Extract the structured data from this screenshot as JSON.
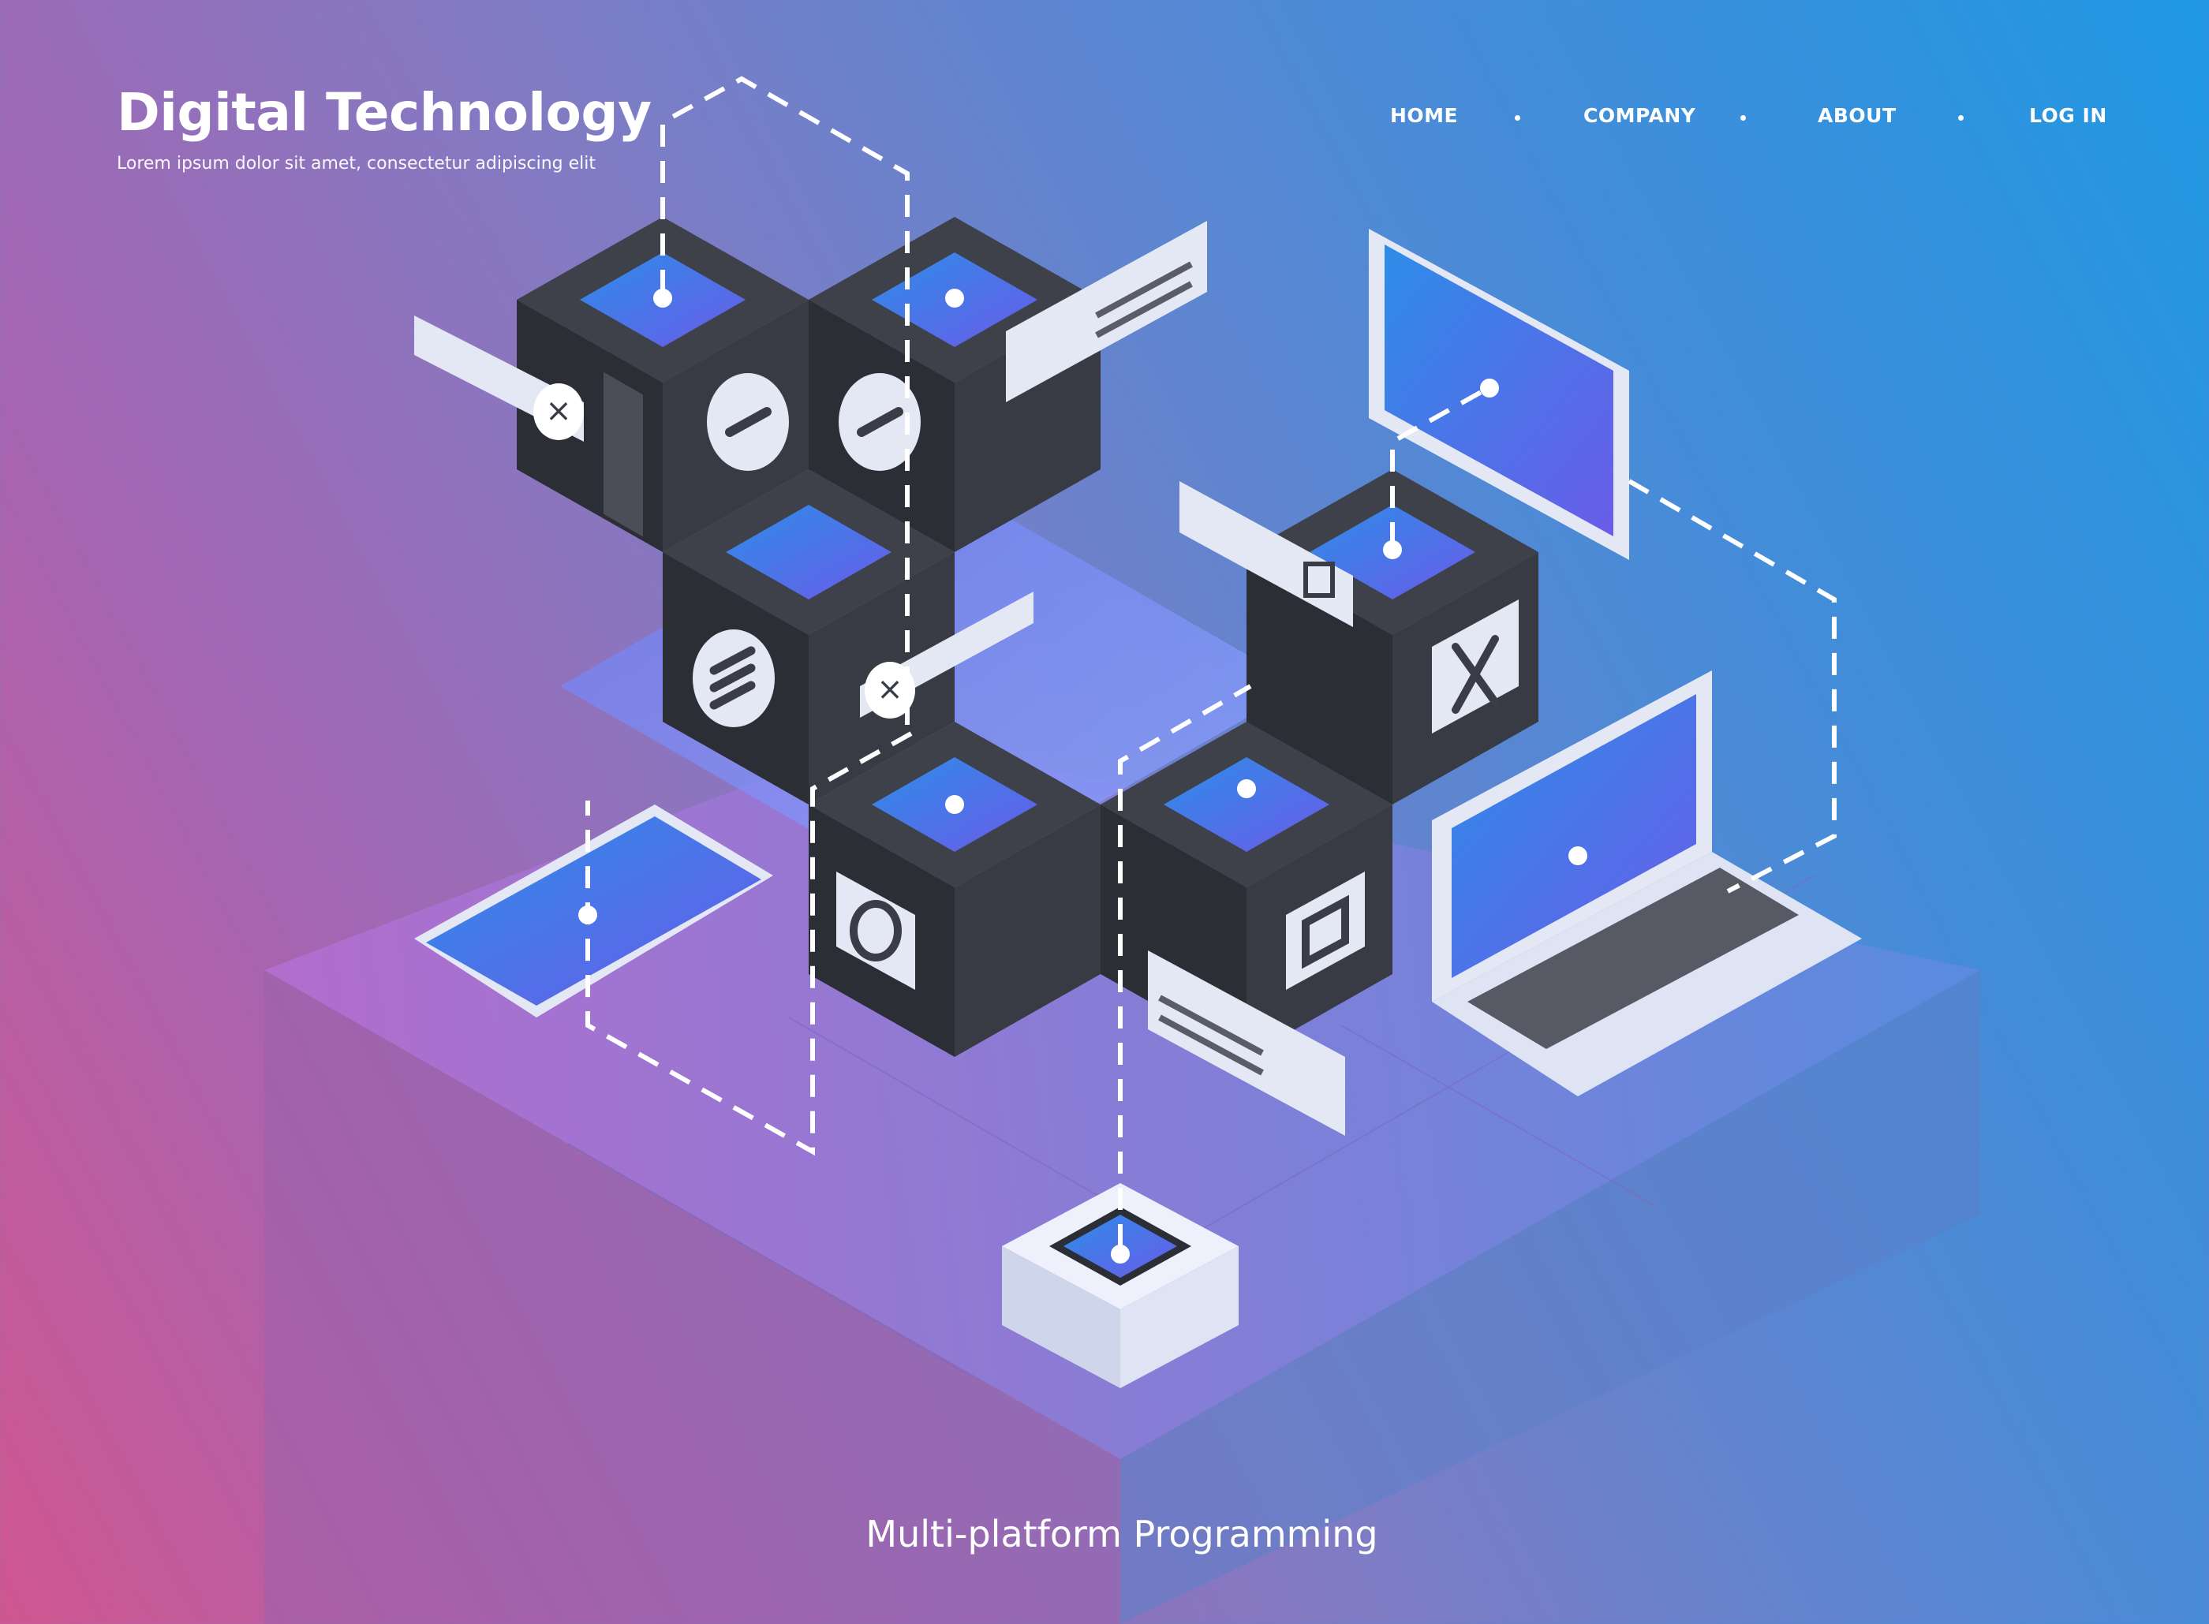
{
  "header": {
    "title": "Digital Technology",
    "subtitle": "Lorem ipsum dolor sit amet, consectetur adipiscing elit"
  },
  "nav": {
    "items": [
      {
        "label": "HOME"
      },
      {
        "label": "COMPANY"
      },
      {
        "label": "ABOUT"
      },
      {
        "label": "LOG IN"
      }
    ]
  },
  "caption": "Multi-platform Programming",
  "colors": {
    "bg_start": "#cf5690",
    "bg_end": "#1f98e3",
    "cube_dark": "#34363f",
    "screen_blue": "#3b7fe8",
    "device_light": "#dfe4f5"
  },
  "icons": [
    "plus-icon",
    "minus-icon",
    "equals-icon",
    "circle-icon",
    "square-icon",
    "cross-icon",
    "key-node-icon"
  ]
}
